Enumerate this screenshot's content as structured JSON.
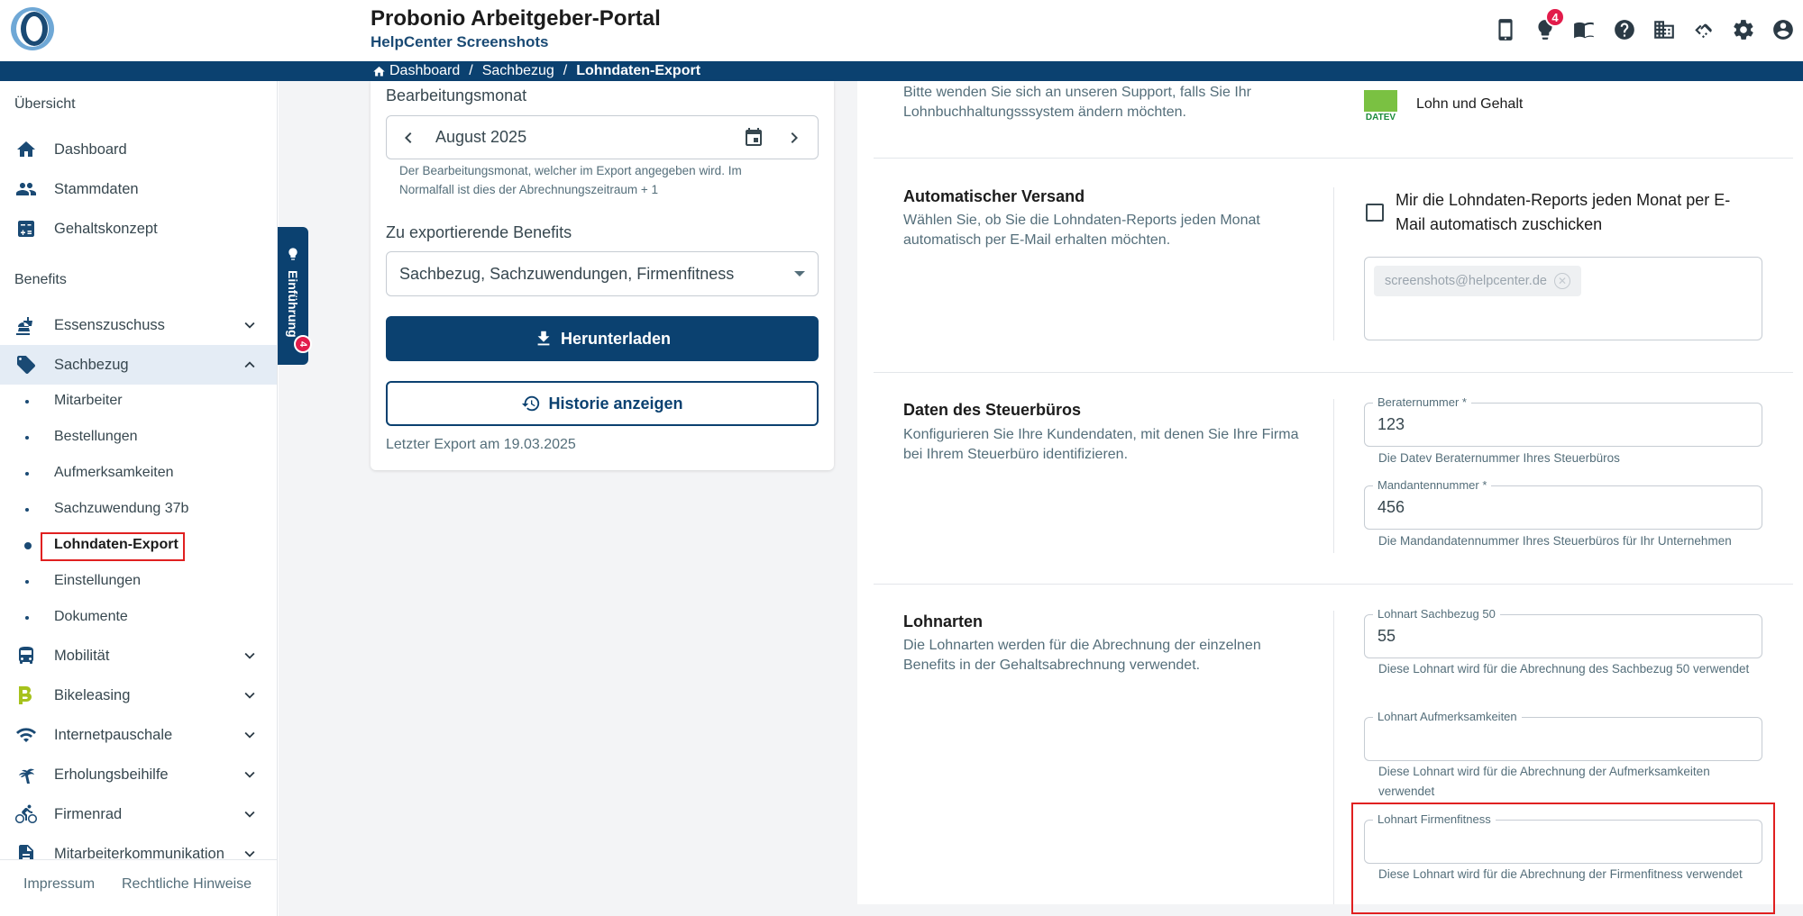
{
  "header": {
    "title": "Probonio Arbeitgeber-Portal",
    "subtitle": "HelpCenter Screenshots",
    "notification_count": "4"
  },
  "breadcrumb": [
    "Dashboard",
    "Sachbezug",
    "Lohndaten-Export"
  ],
  "sidebar": {
    "section_overview": "Übersicht",
    "section_benefits": "Benefits",
    "items": [
      {
        "label": "Dashboard",
        "icon": "home-icon"
      },
      {
        "label": "Stammdaten",
        "icon": "people-icon"
      },
      {
        "label": "Gehaltskonzept",
        "icon": "calculator-icon"
      },
      {
        "label": "Essenszuschuss",
        "icon": "food-icon"
      },
      {
        "label": "Sachbezug",
        "icon": "tag-icon"
      },
      {
        "label": "Mobilität",
        "icon": "bus-icon"
      },
      {
        "label": "Bikeleasing",
        "icon": "bikeleasing-icon"
      },
      {
        "label": "Internetpauschale",
        "icon": "wifi-icon"
      },
      {
        "label": "Erholungsbeihilfe",
        "icon": "palm-icon"
      },
      {
        "label": "Firmenrad",
        "icon": "bike-icon"
      },
      {
        "label": "Mitarbeiterkommunikation",
        "icon": "document-icon"
      }
    ],
    "sub_items": [
      "Mitarbeiter",
      "Bestellungen",
      "Aufmerksamkeiten",
      "Sachzuwendung 37b",
      "Lohndaten-Export",
      "Einstellungen",
      "Dokumente"
    ],
    "footer": {
      "imprint": "Impressum",
      "legal": "Rechtliche Hinweise"
    }
  },
  "intro_tab": {
    "label": "Einführung",
    "badge": "4"
  },
  "export_card": {
    "month_label": "Bearbeitungsmonat",
    "month_value": "August 2025",
    "month_help": "Der Bearbeitungsmonat, welcher im Export angegeben wird. Im Normalfall ist dies der Abrechnungszeitraum + 1",
    "benefits_label": "Zu exportierende Benefits",
    "benefits_value": "Sachbezug, Sachzuwendungen, Firmenfitness",
    "download_button": "Herunterladen",
    "history_button": "Historie anzeigen",
    "last_export": "Letzter Export am 19.03.2025"
  },
  "settings": {
    "support_text": "Bitte wenden Sie sich an unseren Support, falls Sie Ihr Lohnbuchhaltungsssystem ändern möchten.",
    "payroll_system": "Lohn und Gehalt",
    "payroll_logo_text": "DATEV",
    "auto_send": {
      "heading": "Automatischer Versand",
      "description": "Wählen Sie, ob Sie die Lohndaten-Reports jeden Monat automatisch per E-Mail erhalten möchten.",
      "checkbox_label": "Mir die Lohndaten-Reports jeden Monat per E-Mail automatisch zuschicken",
      "checked": false,
      "email_chip": "screenshots@helpcenter.de"
    },
    "tax_office": {
      "heading": "Daten des Steuerbüros",
      "description": "Konfigurieren Sie Ihre Kundendaten, mit denen Sie Ihre Firma bei Ihrem Steuerbüro identifizieren.",
      "advisor_label": "Beraternummer *",
      "advisor_value": "123",
      "advisor_help": "Die Datev Beraternummer Ihres Steuerbüros",
      "client_label": "Mandantennummer *",
      "client_value": "456",
      "client_help": "Die Mandandatennummer Ihres Steuerbüros für Ihr Unternehmen"
    },
    "wage_types": {
      "heading": "Lohnarten",
      "description": "Die Lohnarten werden für die Abrechnung der einzelnen Benefits in der Gehaltsabrechnung verwendet.",
      "sachbezug_label": "Lohnart Sachbezug 50",
      "sachbezug_value": "55",
      "sachbezug_help": "Diese Lohnart wird für die Abrechnung des Sachbezug 50 verwendet",
      "aufmerksamkeiten_label": "Lohnart Aufmerksamkeiten",
      "aufmerksamkeiten_value": "",
      "aufmerksamkeiten_help": "Diese Lohnart wird für die Abrechnung der Aufmerksamkeiten verwendet",
      "firmenfitness_label": "Lohnart Firmenfitness",
      "firmenfitness_value": "",
      "firmenfitness_help": "Diese Lohnart wird für die Abrechnung der Firmenfitness verwendet"
    }
  },
  "colors": {
    "primary": "#0b4170",
    "badge": "#e21c4b",
    "highlight": "#e02020",
    "datev_green": "#7ac142"
  }
}
